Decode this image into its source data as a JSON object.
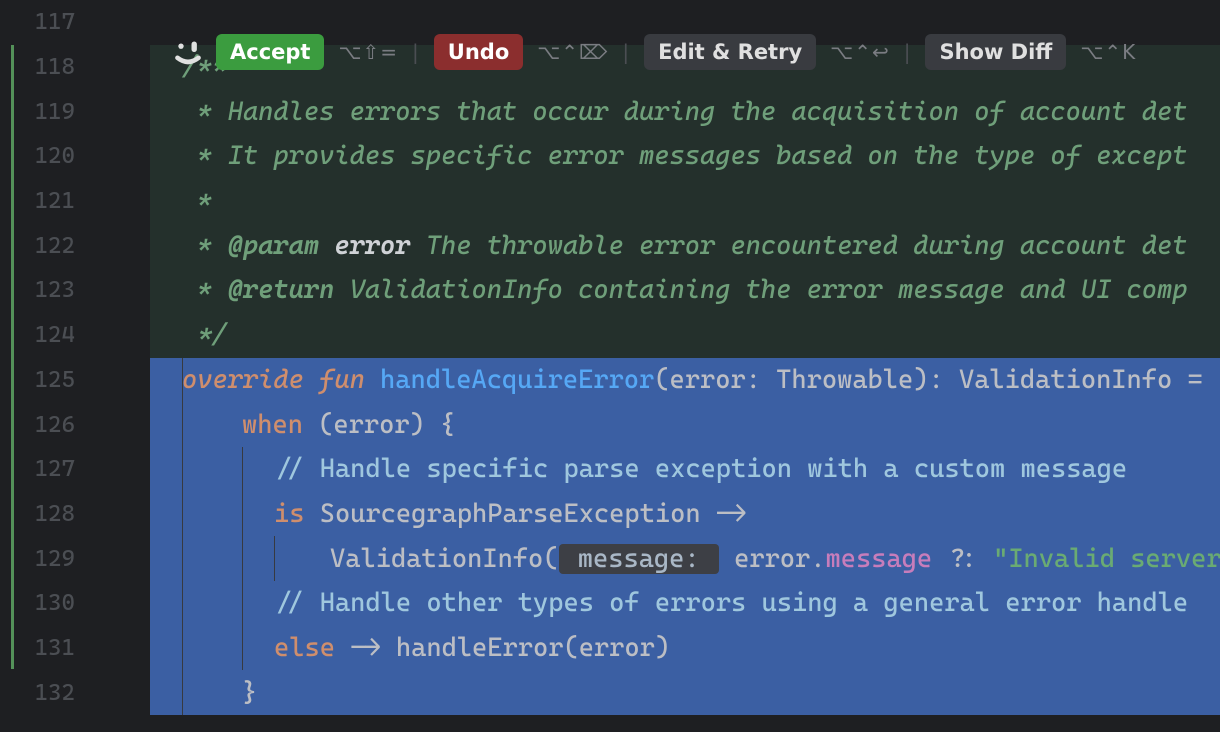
{
  "colors": {
    "accept": "#3b9c3f",
    "undo": "#8b2e2e",
    "default_button": "#393b40",
    "selection": "#3b5fa3",
    "doc_bg": "#24302c",
    "line_number": "#4b4e53"
  },
  "toolbar": {
    "accept": "Accept",
    "accept_shortcut": "⌥⇧=",
    "undo": "Undo",
    "undo_shortcut": "⌥⌃⌦",
    "edit_retry": "Edit & Retry",
    "edit_retry_shortcut": "⌥⌃↩",
    "show_diff": "Show Diff",
    "show_diff_shortcut": "⌥⌃K"
  },
  "gutter": {
    "lines": [
      "117",
      "118",
      "119",
      "120",
      "121",
      "122",
      "123",
      "124",
      "125",
      "126",
      "127",
      "128",
      "129",
      "130",
      "131",
      "132"
    ],
    "icon_line": "125"
  },
  "code": {
    "l117": "",
    "l118": "/**",
    "l119_prefix": " * ",
    "l119_text": "Handles errors that occur during the acquisition of account det",
    "l120_prefix": " * ",
    "l120_text": "It provides specific error messages based on the type of except",
    "l121": " *",
    "l122_prefix": " * ",
    "l122_tag": "@param",
    "l122_name": " error ",
    "l122_text": "The throwable error encountered during account det",
    "l123_prefix": " * ",
    "l123_tag": "@return",
    "l123_text": " ValidationInfo containing the error message and UI comp",
    "l124": " */",
    "l125_override": "override",
    "l125_fun": "fun",
    "l125_name": "handleAcquireError",
    "l125_sig_open": "(",
    "l125_param": "error",
    "l125_colon": ": ",
    "l125_ptype": "Throwable",
    "l125_sig_close": "): ",
    "l125_rtype": "ValidationInfo ",
    "l125_eq": "=",
    "l126_when": "when",
    "l126_rest": " (error) {",
    "l127": "// Handle specific parse exception with a custom message",
    "l128_is": "is",
    "l128_type": " SourcegraphParseException ->",
    "l129_call": "ValidationInfo(",
    "l129_label": " message: ",
    "l129_err": "error",
    "l129_dot": ".",
    "l129_msg": "message",
    "l129_elvis": " ?: ",
    "l129_str": "\"Invalid server ",
    "l130": "// Handle other types of errors using a general error handle",
    "l131_else": "else",
    "l131_rest": " -> handleError(error)",
    "l132": "}"
  }
}
